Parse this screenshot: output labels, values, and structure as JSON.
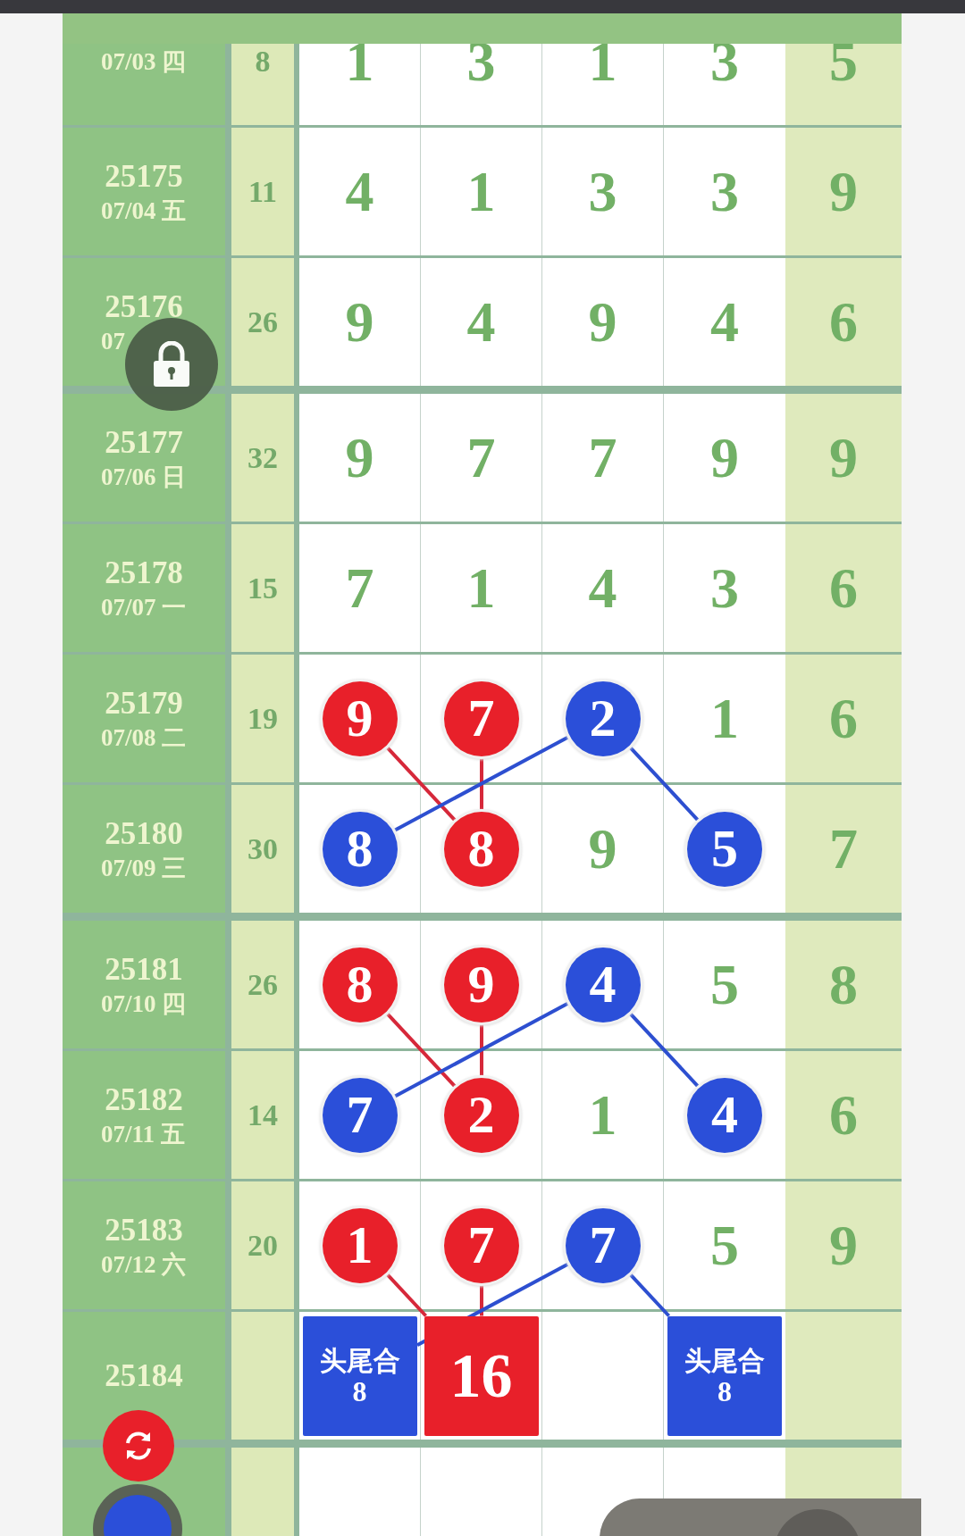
{
  "rows": [
    {
      "date": "07/03 四",
      "sum": "8",
      "group_end": false,
      "cells": [
        {
          "kind": "plain",
          "v": "1"
        },
        {
          "kind": "plain",
          "v": "3"
        },
        {
          "kind": "plain",
          "v": "1"
        },
        {
          "kind": "plain",
          "v": "3"
        }
      ],
      "tail": "5"
    },
    {
      "issue": "25175",
      "date": "07/04 五",
      "sum": "11",
      "group_end": false,
      "cells": [
        {
          "kind": "plain",
          "v": "4"
        },
        {
          "kind": "plain",
          "v": "1"
        },
        {
          "kind": "plain",
          "v": "3"
        },
        {
          "kind": "plain",
          "v": "3"
        }
      ],
      "tail": "9"
    },
    {
      "issue": "25176",
      "date": "07",
      "sum": "26",
      "group_end": true,
      "cells": [
        {
          "kind": "plain",
          "v": "9"
        },
        {
          "kind": "plain",
          "v": "4"
        },
        {
          "kind": "plain",
          "v": "9"
        },
        {
          "kind": "plain",
          "v": "4"
        }
      ],
      "tail": "6"
    },
    {
      "issue": "25177",
      "date": "07/06 日",
      "sum": "32",
      "group_end": false,
      "cells": [
        {
          "kind": "plain",
          "v": "9"
        },
        {
          "kind": "plain",
          "v": "7"
        },
        {
          "kind": "plain",
          "v": "7"
        },
        {
          "kind": "plain",
          "v": "9"
        }
      ],
      "tail": "9"
    },
    {
      "issue": "25178",
      "date": "07/07 一",
      "sum": "15",
      "group_end": false,
      "cells": [
        {
          "kind": "plain",
          "v": "7"
        },
        {
          "kind": "plain",
          "v": "1"
        },
        {
          "kind": "plain",
          "v": "4"
        },
        {
          "kind": "plain",
          "v": "3"
        }
      ],
      "tail": "6"
    },
    {
      "issue": "25179",
      "date": "07/08 二",
      "sum": "19",
      "group_end": false,
      "linked_to_next": true,
      "cells": [
        {
          "kind": "red",
          "v": "9"
        },
        {
          "kind": "red",
          "v": "7"
        },
        {
          "kind": "blue",
          "v": "2"
        },
        {
          "kind": "plain",
          "v": "1"
        }
      ],
      "tail": "6"
    },
    {
      "issue": "25180",
      "date": "07/09 三",
      "sum": "30",
      "group_end": true,
      "linked_to_next": false,
      "cells": [
        {
          "kind": "blue",
          "v": "8"
        },
        {
          "kind": "red",
          "v": "8"
        },
        {
          "kind": "plain",
          "v": "9"
        },
        {
          "kind": "blue",
          "v": "5"
        }
      ],
      "tail": "7"
    },
    {
      "issue": "25181",
      "date": "07/10 四",
      "sum": "26",
      "group_end": false,
      "linked_to_next": true,
      "cells": [
        {
          "kind": "red",
          "v": "8"
        },
        {
          "kind": "red",
          "v": "9"
        },
        {
          "kind": "blue",
          "v": "4"
        },
        {
          "kind": "plain",
          "v": "5"
        }
      ],
      "tail": "8"
    },
    {
      "issue": "25182",
      "date": "07/11 五",
      "sum": "14",
      "group_end": false,
      "linked_to_next": false,
      "cells": [
        {
          "kind": "blue",
          "v": "7"
        },
        {
          "kind": "red",
          "v": "2"
        },
        {
          "kind": "plain",
          "v": "1"
        },
        {
          "kind": "blue",
          "v": "4"
        }
      ],
      "tail": "6"
    },
    {
      "issue": "25183",
      "date": "07/12 六",
      "sum": "20",
      "group_end": false,
      "linked_to_next": true,
      "cells": [
        {
          "kind": "red",
          "v": "1"
        },
        {
          "kind": "red",
          "v": "7"
        },
        {
          "kind": "blue",
          "v": "7"
        },
        {
          "kind": "plain",
          "v": "5"
        }
      ],
      "tail": "9"
    },
    {
      "issue": "25184",
      "group_end": true,
      "cells": [
        {
          "kind": "blue-box",
          "label": "头尾合",
          "v": "8"
        },
        {
          "kind": "red-box",
          "v": "16"
        },
        {
          "kind": "empty"
        },
        {
          "kind": "blue-box",
          "label": "头尾合",
          "v": "8"
        }
      ]
    },
    {
      "group_end": false,
      "cells": [
        {
          "kind": "empty"
        },
        {
          "kind": "empty"
        },
        {
          "kind": "empty"
        },
        {
          "kind": "empty"
        }
      ]
    }
  ]
}
